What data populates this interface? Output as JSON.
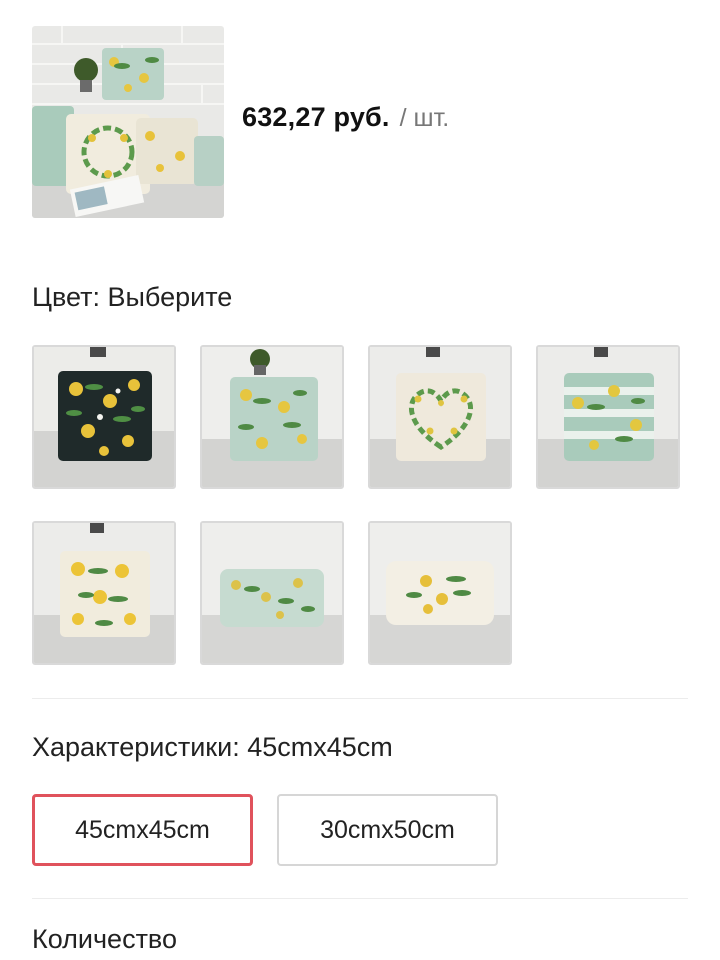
{
  "product": {
    "image_icon": "cushion-photo",
    "price": "632,27 руб.",
    "unit": "/ шт."
  },
  "color": {
    "title": "Цвет: Выберите",
    "options": [
      {
        "icon": "lemon-cushion-navy",
        "bg": "#1f2a2a",
        "accent": "#e8c23a"
      },
      {
        "icon": "lemon-cushion-mint",
        "bg": "#b9d3c7",
        "accent": "#e6c640"
      },
      {
        "icon": "lemon-wreath-cushion",
        "bg": "#efe9dc",
        "accent": "#e0c440"
      },
      {
        "icon": "lemon-cushion-stripes",
        "bg": "#a9cbbb",
        "accent": "#e3c73f"
      },
      {
        "icon": "lemon-cushion-cream",
        "bg": "#f1ecdd",
        "accent": "#ecc437"
      },
      {
        "icon": "lemon-bolster-mint",
        "bg": "#c6dbd0",
        "accent": "#dcc24a"
      },
      {
        "icon": "lemon-bolster-cream",
        "bg": "#f3efe4",
        "accent": "#e6bf3a"
      }
    ]
  },
  "size": {
    "title": "Характеристики: 45cmx45cm",
    "options": [
      {
        "label": "45cmx45cm",
        "selected": true
      },
      {
        "label": "30cmx50cm",
        "selected": false
      }
    ]
  },
  "quantity": {
    "title": "Количество"
  },
  "colors": {
    "selected_border": "#e0525c",
    "border": "#d6d6d6",
    "price": "#111111"
  }
}
